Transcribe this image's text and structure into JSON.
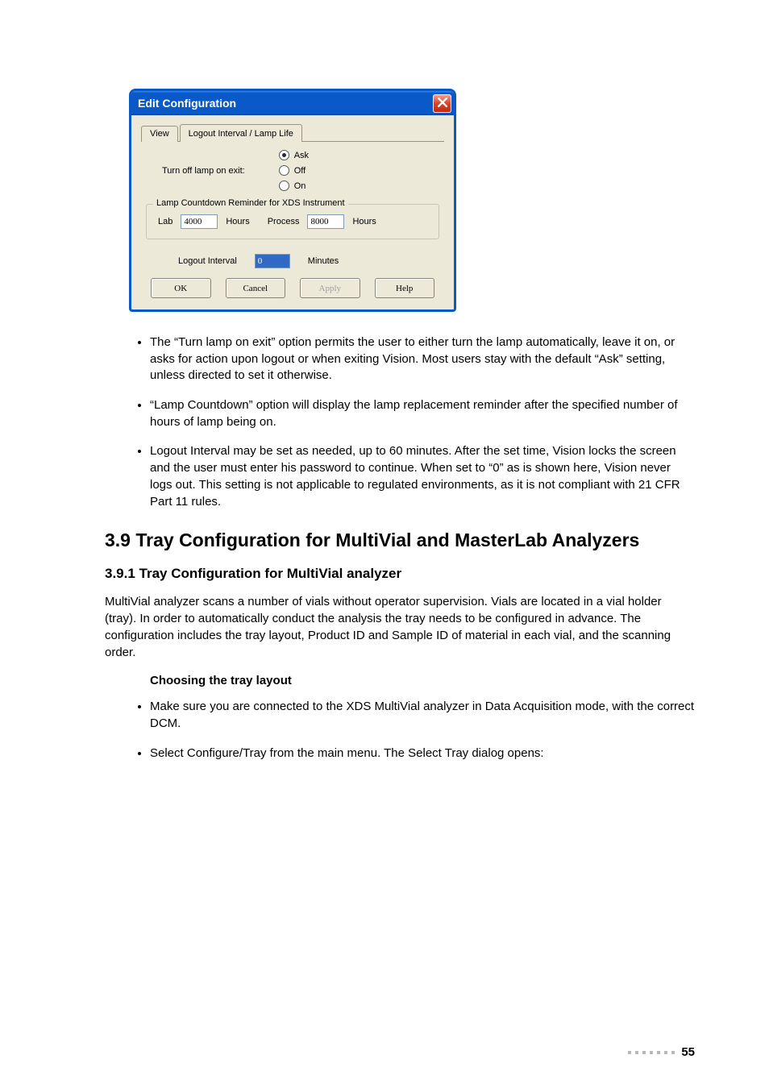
{
  "dialog": {
    "title": "Edit Configuration",
    "tabs": {
      "view": "View",
      "logout": "Logout Interval / Lamp Life"
    },
    "lamp_label": "Turn off lamp on exit:",
    "radios": {
      "ask": "Ask",
      "off": "Off",
      "on": "On"
    },
    "fieldset_legend": "Lamp Countdown Reminder for XDS Instrument",
    "lab_label": "Lab",
    "lab_value": "4000",
    "hours1": "Hours",
    "process_label": "Process",
    "process_value": "8000",
    "hours2": "Hours",
    "logout_label": "Logout Interval",
    "logout_value": "0",
    "minutes": "Minutes",
    "buttons": {
      "ok": "OK",
      "cancel": "Cancel",
      "apply": "Apply",
      "help": "Help"
    }
  },
  "body": {
    "b1": "The “Turn lamp on exit” option permits the user to either turn the lamp automatically, leave it on, or asks for action upon logout or when exiting Vision. Most users stay with the default “Ask” setting, unless directed to set it otherwise.",
    "b2": "“Lamp Countdown” option will display the lamp replacement reminder after the specified number of hours of lamp being on.",
    "b3": "Logout Interval may be set as needed, up to 60 minutes. After the set time, Vision locks the screen and the user must enter his password to continue. When set to “0” as is shown here, Vision never logs out. This setting is not applicable to regulated environments, as it is not compliant with 21 CFR Part 11 rules.",
    "h2": "3.9   Tray Configuration for MultiVial and MasterLab Analyzers",
    "h3": "3.9.1    Tray Configuration for MultiVial analyzer",
    "p1": "MultiVial analyzer scans a number of vials without operator supervision. Vials are located in a vial holder (tray). In order to automatically conduct the analysis the tray needs to be configured in advance. The configuration includes the tray layout, Product ID and Sample ID of material in each vial, and the scanning order.",
    "runin": "Choosing the tray layout",
    "b4": "Make sure you are connected to the XDS MultiVial analyzer in Data Acquisition mode, with the correct DCM.",
    "b5": "Select Configure/Tray from the main menu. The Select Tray dialog opens:"
  },
  "page_number": "55"
}
